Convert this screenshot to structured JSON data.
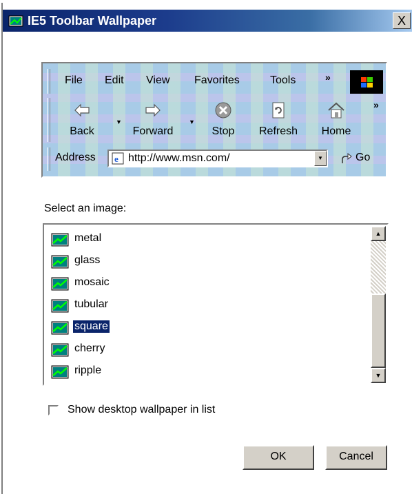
{
  "window": {
    "title": "IE5 Toolbar Wallpaper",
    "close_label": "X"
  },
  "preview": {
    "menu": [
      "File",
      "Edit",
      "View",
      "Favorites",
      "Tools"
    ],
    "menu_chevron": "»",
    "toolbar_chevron": "»",
    "toolbar": [
      {
        "label": "Back",
        "icon": "back-arrow-icon"
      },
      {
        "label": "Forward",
        "icon": "forward-arrow-icon"
      },
      {
        "label": "Stop",
        "icon": "stop-icon"
      },
      {
        "label": "Refresh",
        "icon": "refresh-icon"
      },
      {
        "label": "Home",
        "icon": "home-icon"
      }
    ],
    "address_label": "Address",
    "address_value": "http://www.msn.com/",
    "go_label": "Go"
  },
  "select_label": "Select an image:",
  "images": [
    {
      "name": "metal",
      "selected": false
    },
    {
      "name": "glass",
      "selected": false
    },
    {
      "name": "mosaic",
      "selected": false
    },
    {
      "name": "tubular",
      "selected": false
    },
    {
      "name": "square",
      "selected": true
    },
    {
      "name": "cherry",
      "selected": false
    },
    {
      "name": "ripple",
      "selected": false
    }
  ],
  "show_desktop_label": "Show desktop wallpaper in list",
  "show_desktop_checked": false,
  "ok_label": "OK",
  "cancel_label": "Cancel",
  "colors": {
    "selection": "#0a246a",
    "titlebar": "#0a246a",
    "preview_bg": "#a8cbe7"
  }
}
